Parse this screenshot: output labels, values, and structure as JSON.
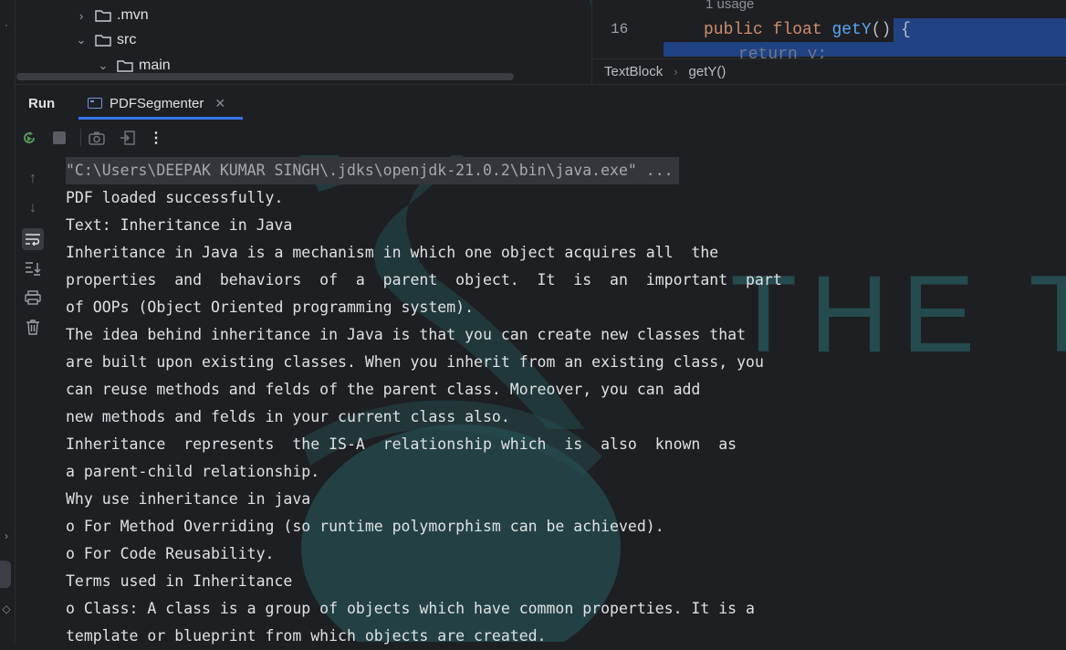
{
  "project_tree": {
    "items": [
      {
        "label": ".mvn",
        "expanded": false
      },
      {
        "label": "src",
        "expanded": true
      },
      {
        "label": "main",
        "expanded": true
      }
    ]
  },
  "editor": {
    "usage_hint": "1 usage",
    "line_number": "16",
    "code": {
      "kw1": "public",
      "kw2": "float",
      "fn": "getY",
      "rest": "() {"
    },
    "next_line_fragment": "return y;",
    "breadcrumb": [
      "TextBlock",
      "getY()"
    ]
  },
  "run_window": {
    "title": "Run",
    "tab_label": "PDFSegmenter"
  },
  "console": {
    "lines": [
      "\"C:\\Users\\DEEPAK KUMAR SINGH\\.jdks\\openjdk-21.0.2\\bin\\java.exe\" ...",
      "PDF loaded successfully.",
      "Text: Inheritance in Java",
      "Inheritance in Java is a mechanism in which one object acquires all  the",
      "properties  and  behaviors  of  a  parent  object.  It  is  an  important  part",
      "of OOPs (Object Oriented programming system).",
      "The idea behind inheritance in Java is that you can create new classes that",
      "are built upon existing classes. When you inherit from an existing class, you",
      "can reuse methods and felds of the parent class. Moreover, you can add",
      "new methods and felds in your current class also.",
      "Inheritance  represents  the IS-A  relationship which  is  also  known  as",
      "a parent-child relationship.",
      "Why use inheritance in java",
      "o For Method Overriding (so runtime polymorphism can be achieved).",
      "o For Code Reusability.",
      "Terms used in Inheritance",
      "o Class: A class is a group of objects which have common properties. It is a",
      "template or blueprint from which objects are created."
    ]
  },
  "watermark_text": "THE TIN",
  "colors": {
    "background": "#1e1f22",
    "accent": "#3574f0",
    "selection": "#214283",
    "watermark": "#2a5a5e"
  }
}
